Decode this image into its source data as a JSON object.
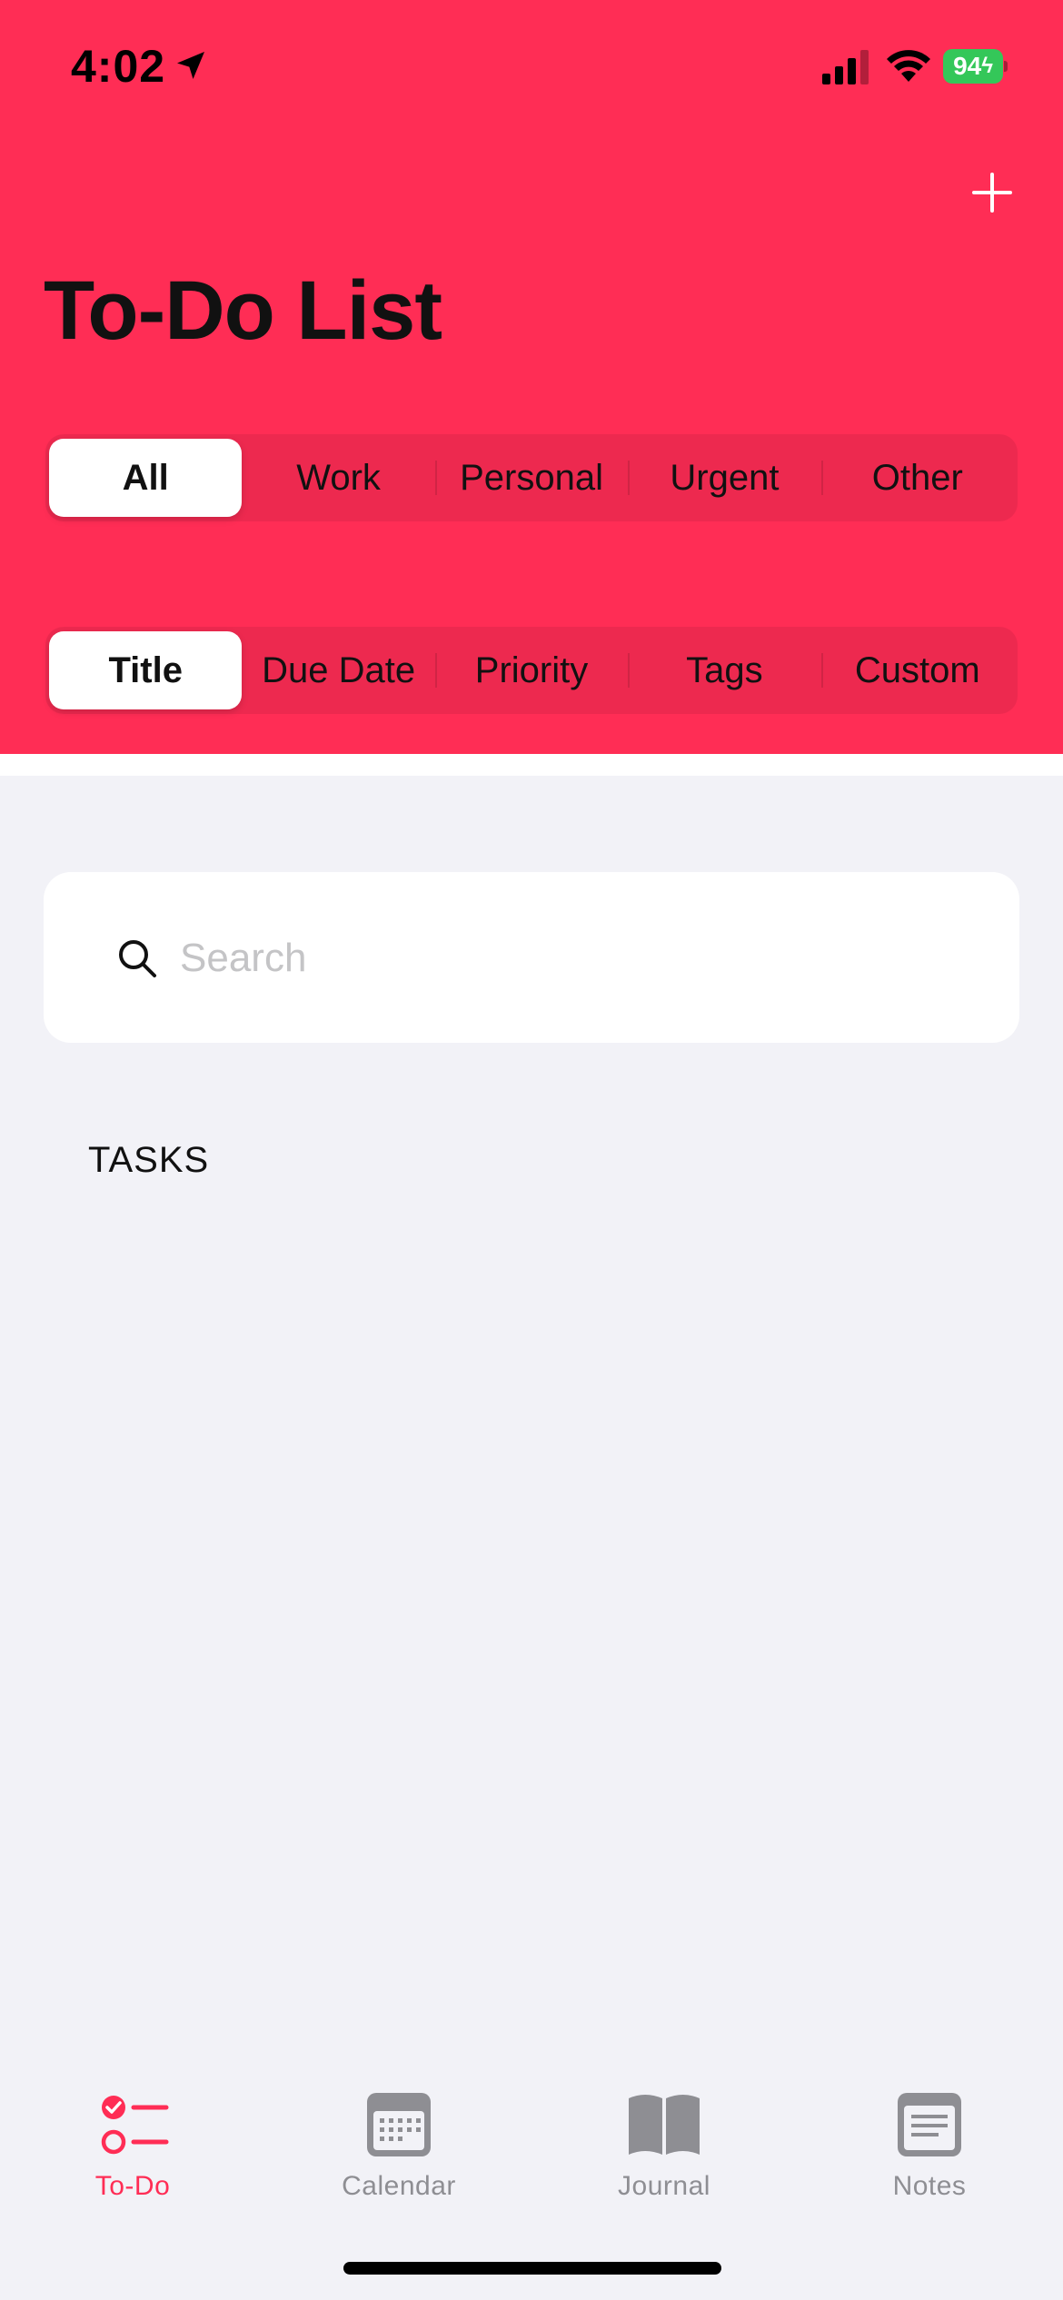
{
  "status_bar": {
    "time": "4:02",
    "battery": "94"
  },
  "header": {
    "title": "To-Do List",
    "add_icon": "plus-icon",
    "background_color": "#FF2D55"
  },
  "filter_segments": {
    "selected": "All",
    "items": [
      "All",
      "Work",
      "Personal",
      "Urgent",
      "Other"
    ]
  },
  "sort_segments": {
    "selected": "Title",
    "items": [
      "Title",
      "Due Date",
      "Priority",
      "Tags",
      "Custom"
    ]
  },
  "search": {
    "placeholder": "Search",
    "value": ""
  },
  "tasks_section": {
    "header": "TASKS",
    "items": []
  },
  "tab_bar": {
    "active": "To-Do",
    "accent_color": "#FF2D55",
    "inactive_color": "#8E8E93",
    "tabs": [
      {
        "label": "To-Do",
        "icon": "checklist-icon"
      },
      {
        "label": "Calendar",
        "icon": "calendar-icon"
      },
      {
        "label": "Journal",
        "icon": "book-icon"
      },
      {
        "label": "Notes",
        "icon": "note-icon"
      }
    ]
  }
}
